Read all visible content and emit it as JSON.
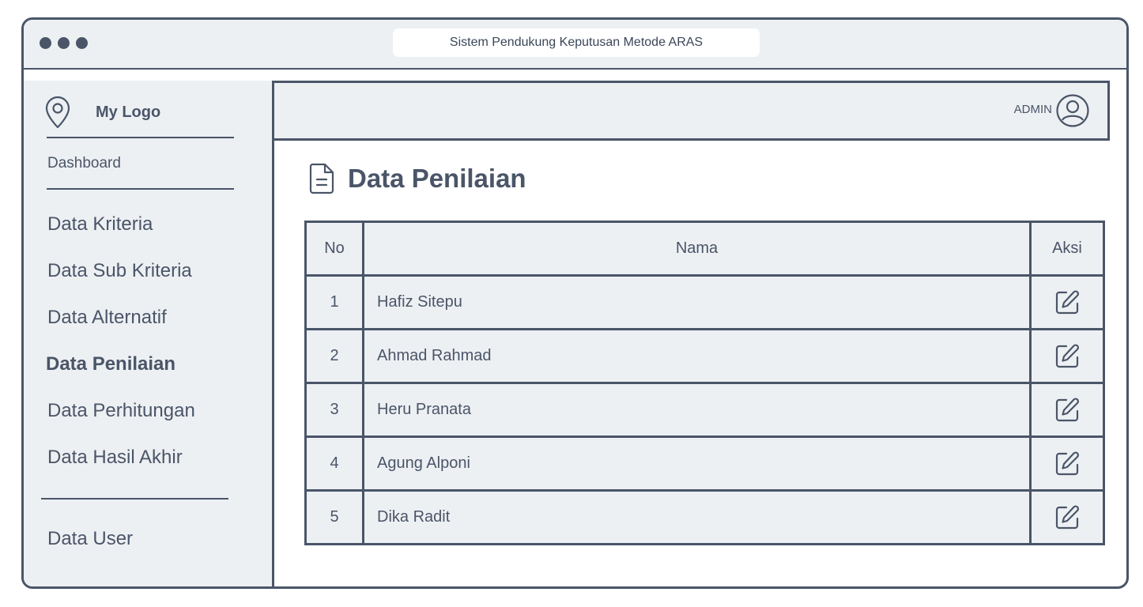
{
  "window": {
    "title": "Sistem Pendukung Keputusan Metode ARAS"
  },
  "sidebar": {
    "logo_text": "My Logo",
    "dashboard_label": "Dashboard",
    "items": [
      {
        "label": "Data Kriteria"
      },
      {
        "label": "Data Sub Kriteria"
      },
      {
        "label": "Data Alternatif"
      },
      {
        "label": "Data Penilaian"
      },
      {
        "label": "Data Perhitungan"
      },
      {
        "label": "Data Hasil Akhir"
      }
    ],
    "user_item": "Data User"
  },
  "topbar": {
    "user_label": "ADMIN"
  },
  "page": {
    "title": "Data Penilaian",
    "title_icon": "document-icon"
  },
  "table": {
    "headers": {
      "no": "No",
      "nama": "Nama",
      "aksi": "Aksi"
    },
    "rows": [
      {
        "no": "1",
        "nama": "Hafiz Sitepu"
      },
      {
        "no": "2",
        "nama": "Ahmad Rahmad"
      },
      {
        "no": "3",
        "nama": "Heru Pranata"
      },
      {
        "no": "4",
        "nama": "Agung Alponi"
      },
      {
        "no": "5",
        "nama": "Dika Radit"
      }
    ],
    "action_icon": "edit-icon"
  },
  "colors": {
    "stroke": "#4a5568",
    "panel": "#edf0f3",
    "background": "#ffffff"
  }
}
